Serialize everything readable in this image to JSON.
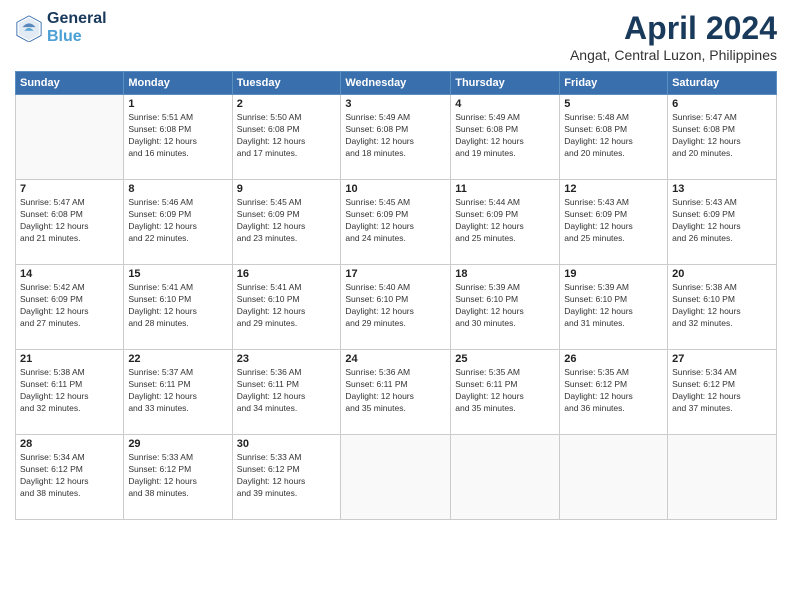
{
  "logo": {
    "line1": "General",
    "line2": "Blue"
  },
  "title": "April 2024",
  "location": "Angat, Central Luzon, Philippines",
  "weekdays": [
    "Sunday",
    "Monday",
    "Tuesday",
    "Wednesday",
    "Thursday",
    "Friday",
    "Saturday"
  ],
  "days": [
    {
      "num": "",
      "info": ""
    },
    {
      "num": "1",
      "info": "Sunrise: 5:51 AM\nSunset: 6:08 PM\nDaylight: 12 hours\nand 16 minutes."
    },
    {
      "num": "2",
      "info": "Sunrise: 5:50 AM\nSunset: 6:08 PM\nDaylight: 12 hours\nand 17 minutes."
    },
    {
      "num": "3",
      "info": "Sunrise: 5:49 AM\nSunset: 6:08 PM\nDaylight: 12 hours\nand 18 minutes."
    },
    {
      "num": "4",
      "info": "Sunrise: 5:49 AM\nSunset: 6:08 PM\nDaylight: 12 hours\nand 19 minutes."
    },
    {
      "num": "5",
      "info": "Sunrise: 5:48 AM\nSunset: 6:08 PM\nDaylight: 12 hours\nand 20 minutes."
    },
    {
      "num": "6",
      "info": "Sunrise: 5:47 AM\nSunset: 6:08 PM\nDaylight: 12 hours\nand 20 minutes."
    },
    {
      "num": "7",
      "info": "Sunrise: 5:47 AM\nSunset: 6:08 PM\nDaylight: 12 hours\nand 21 minutes."
    },
    {
      "num": "8",
      "info": "Sunrise: 5:46 AM\nSunset: 6:09 PM\nDaylight: 12 hours\nand 22 minutes."
    },
    {
      "num": "9",
      "info": "Sunrise: 5:45 AM\nSunset: 6:09 PM\nDaylight: 12 hours\nand 23 minutes."
    },
    {
      "num": "10",
      "info": "Sunrise: 5:45 AM\nSunset: 6:09 PM\nDaylight: 12 hours\nand 24 minutes."
    },
    {
      "num": "11",
      "info": "Sunrise: 5:44 AM\nSunset: 6:09 PM\nDaylight: 12 hours\nand 25 minutes."
    },
    {
      "num": "12",
      "info": "Sunrise: 5:43 AM\nSunset: 6:09 PM\nDaylight: 12 hours\nand 25 minutes."
    },
    {
      "num": "13",
      "info": "Sunrise: 5:43 AM\nSunset: 6:09 PM\nDaylight: 12 hours\nand 26 minutes."
    },
    {
      "num": "14",
      "info": "Sunrise: 5:42 AM\nSunset: 6:09 PM\nDaylight: 12 hours\nand 27 minutes."
    },
    {
      "num": "15",
      "info": "Sunrise: 5:41 AM\nSunset: 6:10 PM\nDaylight: 12 hours\nand 28 minutes."
    },
    {
      "num": "16",
      "info": "Sunrise: 5:41 AM\nSunset: 6:10 PM\nDaylight: 12 hours\nand 29 minutes."
    },
    {
      "num": "17",
      "info": "Sunrise: 5:40 AM\nSunset: 6:10 PM\nDaylight: 12 hours\nand 29 minutes."
    },
    {
      "num": "18",
      "info": "Sunrise: 5:39 AM\nSunset: 6:10 PM\nDaylight: 12 hours\nand 30 minutes."
    },
    {
      "num": "19",
      "info": "Sunrise: 5:39 AM\nSunset: 6:10 PM\nDaylight: 12 hours\nand 31 minutes."
    },
    {
      "num": "20",
      "info": "Sunrise: 5:38 AM\nSunset: 6:10 PM\nDaylight: 12 hours\nand 32 minutes."
    },
    {
      "num": "21",
      "info": "Sunrise: 5:38 AM\nSunset: 6:11 PM\nDaylight: 12 hours\nand 32 minutes."
    },
    {
      "num": "22",
      "info": "Sunrise: 5:37 AM\nSunset: 6:11 PM\nDaylight: 12 hours\nand 33 minutes."
    },
    {
      "num": "23",
      "info": "Sunrise: 5:36 AM\nSunset: 6:11 PM\nDaylight: 12 hours\nand 34 minutes."
    },
    {
      "num": "24",
      "info": "Sunrise: 5:36 AM\nSunset: 6:11 PM\nDaylight: 12 hours\nand 35 minutes."
    },
    {
      "num": "25",
      "info": "Sunrise: 5:35 AM\nSunset: 6:11 PM\nDaylight: 12 hours\nand 35 minutes."
    },
    {
      "num": "26",
      "info": "Sunrise: 5:35 AM\nSunset: 6:12 PM\nDaylight: 12 hours\nand 36 minutes."
    },
    {
      "num": "27",
      "info": "Sunrise: 5:34 AM\nSunset: 6:12 PM\nDaylight: 12 hours\nand 37 minutes."
    },
    {
      "num": "28",
      "info": "Sunrise: 5:34 AM\nSunset: 6:12 PM\nDaylight: 12 hours\nand 38 minutes."
    },
    {
      "num": "29",
      "info": "Sunrise: 5:33 AM\nSunset: 6:12 PM\nDaylight: 12 hours\nand 38 minutes."
    },
    {
      "num": "30",
      "info": "Sunrise: 5:33 AM\nSunset: 6:12 PM\nDaylight: 12 hours\nand 39 minutes."
    },
    {
      "num": "",
      "info": ""
    },
    {
      "num": "",
      "info": ""
    },
    {
      "num": "",
      "info": ""
    },
    {
      "num": "",
      "info": ""
    }
  ]
}
